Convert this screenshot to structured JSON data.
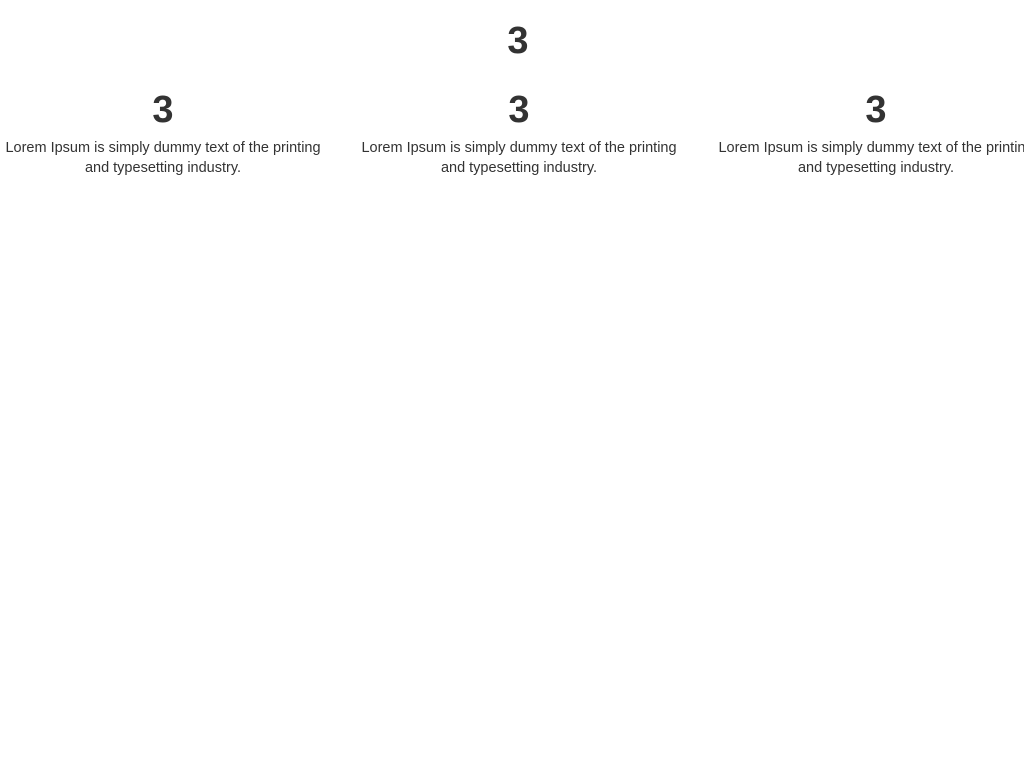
{
  "main": {
    "heading": "3",
    "features": [
      {
        "heading": "3",
        "text_line1": "Lorem Ipsum is simply dummy text of the printing",
        "text_line2": "and typesetting industry."
      },
      {
        "heading": "3",
        "text_line1": "Lorem Ipsum is simply dummy text of the printing",
        "text_line2": "and typesetting industry."
      },
      {
        "heading": "3",
        "text_line1": "Lorem Ipsum is simply dummy text of the printing",
        "text_line2": "and typesetting industry."
      }
    ]
  }
}
